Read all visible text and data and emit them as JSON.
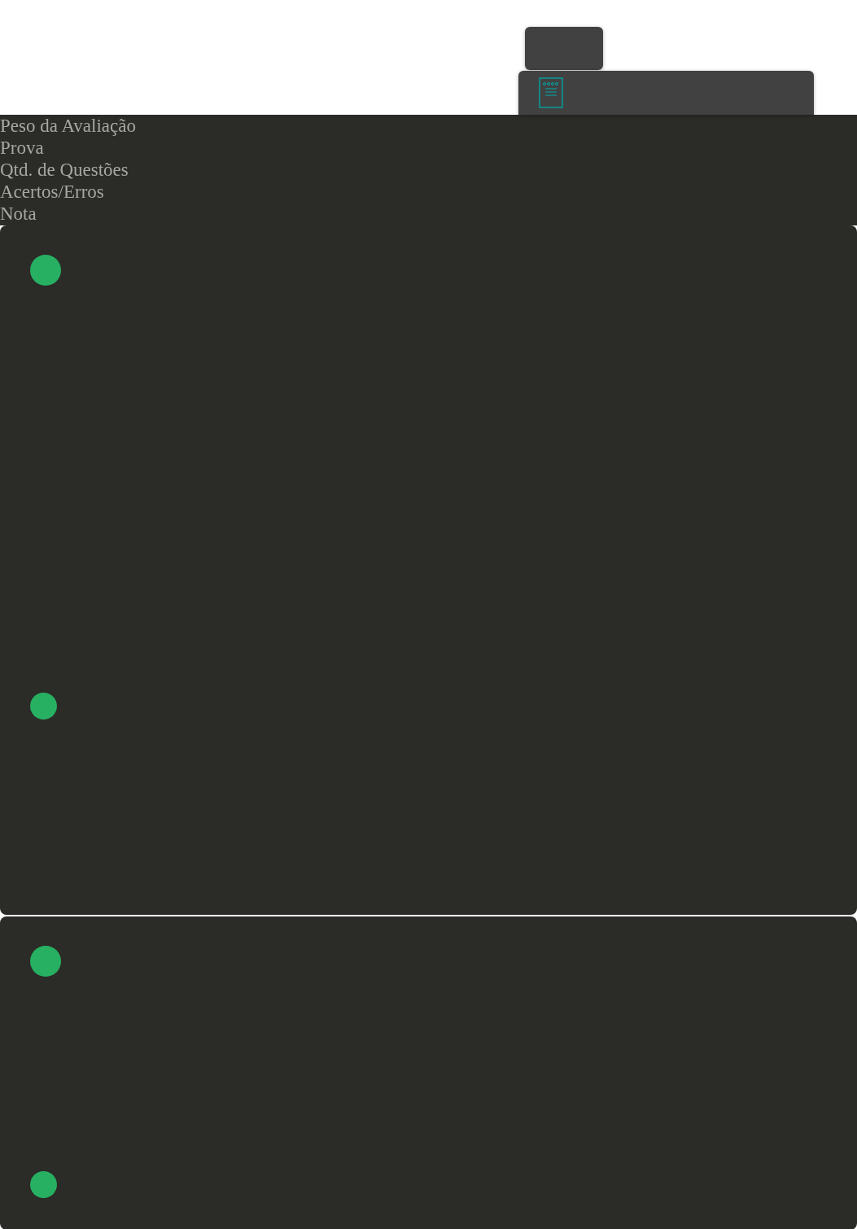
{
  "columns": [
    {
      "label": "Peso da Avaliação"
    },
    {
      "label": "Prova"
    },
    {
      "label": "Qtd. de Questões"
    },
    {
      "label": "Acertos/Erros"
    },
    {
      "label": "Nota"
    }
  ],
  "cards": [
    {
      "markers": [
        {
          "kind": "large"
        },
        {
          "kind": "small"
        }
      ]
    },
    {
      "markers": [
        {
          "kind": "large"
        },
        {
          "kind": "small"
        }
      ]
    }
  ]
}
